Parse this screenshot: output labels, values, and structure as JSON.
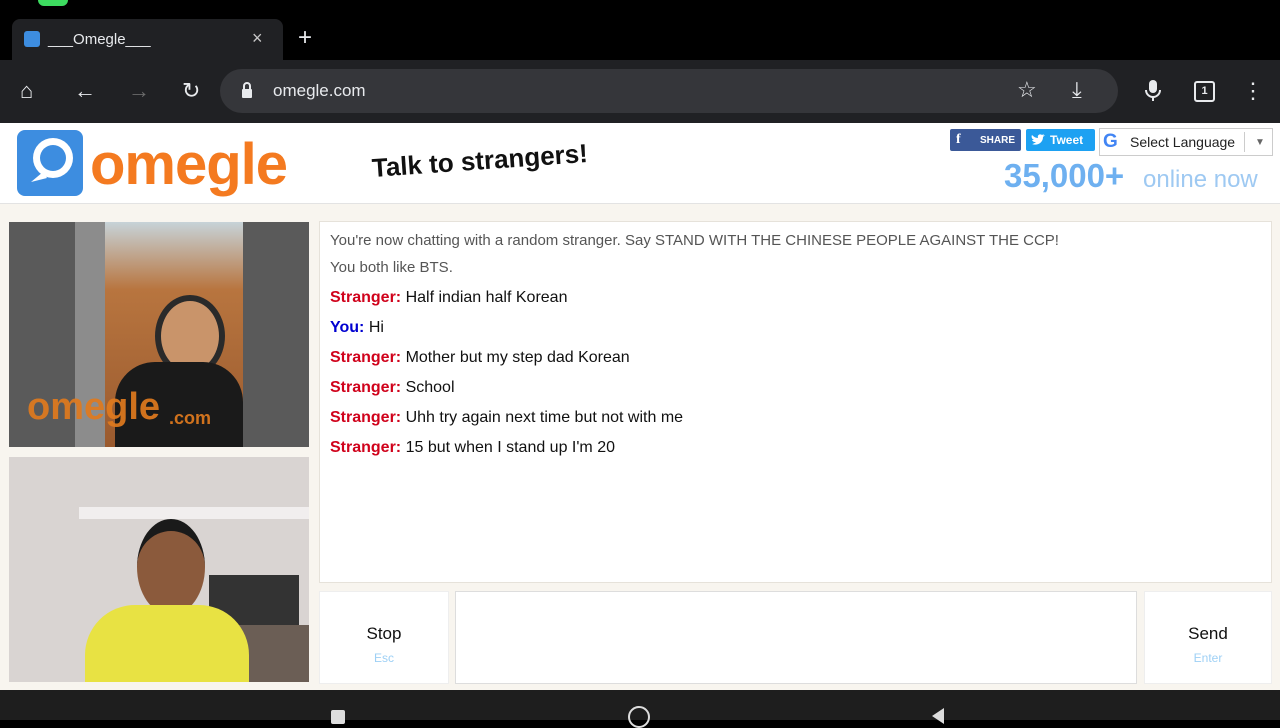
{
  "tab": {
    "title": "___Omegle___",
    "close": "×",
    "new_tab": "+"
  },
  "toolbar": {
    "url": "omegle.com",
    "home": "⌂",
    "back": "←",
    "forward": "→",
    "reload": "↻",
    "star": "☆",
    "download": "⤓",
    "more": "⋮",
    "tabs_count": "1"
  },
  "header": {
    "logo": "omegle",
    "tagline": "Talk to strangers!",
    "share": "SHARE",
    "tweet": "Tweet",
    "language": "Select Language",
    "online_count": "35,000+",
    "online_label": "online now"
  },
  "video": {
    "watermark": "omegle",
    "watermark_suffix": ".com"
  },
  "chat": {
    "system_messages": [
      "You're now chatting with a random stranger. Say STAND WITH THE CHINESE PEOPLE AGAINST THE CCP!",
      "You both like BTS."
    ],
    "messages": [
      {
        "speaker": "Stranger:",
        "text": "Half indian half Korean"
      },
      {
        "speaker": "You:",
        "text": "Hi"
      },
      {
        "speaker": "Stranger:",
        "text": "Mother but my step dad Korean"
      },
      {
        "speaker": "Stranger:",
        "text": "School"
      },
      {
        "speaker": "Stranger:",
        "text": "Uhh try again next time but not with me"
      },
      {
        "speaker": "Stranger:",
        "text": "15 but when I stand up I'm 20"
      }
    ]
  },
  "controls": {
    "stop": "Stop",
    "stop_hint": "Esc",
    "send": "Send",
    "send_hint": "Enter"
  },
  "colors": {
    "brand": "#f47a20",
    "stranger": "#d0021b",
    "you": "#0000d0",
    "online": "#6eb0f0"
  }
}
